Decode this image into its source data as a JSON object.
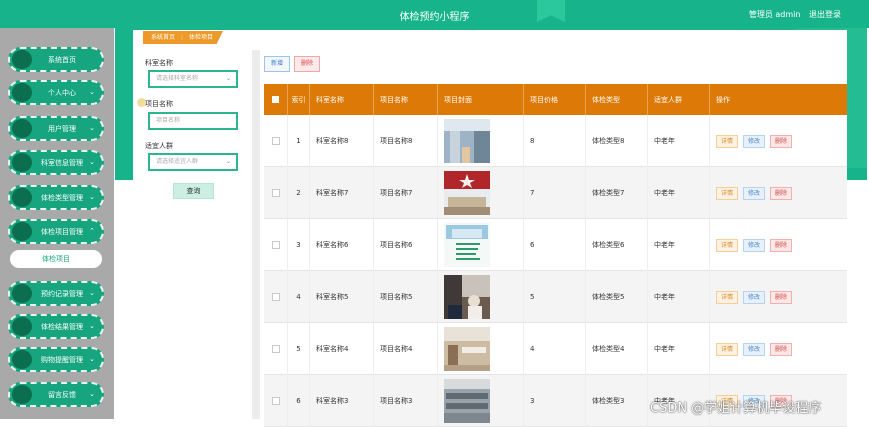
{
  "header": {
    "title": "体检预约小程序",
    "admin_label": "管理员 admin",
    "logout_label": "退出登录"
  },
  "sidebar": {
    "items": [
      {
        "label": "系统首页",
        "chevron": ""
      },
      {
        "label": "个人中心",
        "chevron": "⌄"
      },
      {
        "label": "用户管理",
        "chevron": "⌄"
      },
      {
        "label": "科室信息管理",
        "chevron": "⌄"
      },
      {
        "label": "体检类型管理",
        "chevron": "⌄"
      },
      {
        "label": "体检项目管理",
        "chevron": "⌃"
      },
      {
        "label": "预约记录管理",
        "chevron": "⌄"
      },
      {
        "label": "体检结果管理",
        "chevron": "⌄"
      },
      {
        "label": "购物提醒管理",
        "chevron": "⌄"
      },
      {
        "label": "留言反馈",
        "chevron": "⌄"
      }
    ],
    "sub_item": "体检项目"
  },
  "breadcrumb": {
    "home": "系统首页",
    "separator": "⋮",
    "current": "体检项目"
  },
  "search": {
    "dept_label": "科室名称",
    "dept_placeholder": "请选择科室名称",
    "item_label": "项目名称",
    "item_placeholder": "项目名称",
    "crowd_label": "适宜人群",
    "crowd_placeholder": "请选择适宜人群",
    "query_button": "查询"
  },
  "toolbar": {
    "add_label": "新增",
    "delete_label": "删除"
  },
  "table": {
    "headers": [
      "索引",
      "科室名称",
      "项目名称",
      "项目封面",
      "项目价格",
      "体检类型",
      "适宜人群",
      "操作"
    ],
    "actions": {
      "detail": "详情",
      "edit": "修改",
      "delete": "删除"
    },
    "rows": [
      {
        "index": "1",
        "dept": "科室名称8",
        "item": "项目名称8",
        "price": "8",
        "type": "体检类型8",
        "crowd": "中老年"
      },
      {
        "index": "2",
        "dept": "科室名称7",
        "item": "项目名称7",
        "price": "7",
        "type": "体检类型7",
        "crowd": "中老年"
      },
      {
        "index": "3",
        "dept": "科室名称6",
        "item": "项目名称6",
        "price": "6",
        "type": "体检类型6",
        "crowd": "中老年"
      },
      {
        "index": "4",
        "dept": "科室名称5",
        "item": "项目名称5",
        "price": "5",
        "type": "体检类型5",
        "crowd": "中老年"
      },
      {
        "index": "5",
        "dept": "科室名称4",
        "item": "项目名称4",
        "price": "4",
        "type": "体检类型4",
        "crowd": "中老年"
      },
      {
        "index": "6",
        "dept": "科室名称3",
        "item": "项目名称3",
        "price": "3",
        "type": "体检类型3",
        "crowd": "中老年"
      }
    ]
  },
  "watermark": "CSDN @学姐计算机毕设程序",
  "colors": {
    "primary": "#17b48b",
    "header_row": "#dd7a07",
    "breadcrumb": "#ed9a2a"
  }
}
